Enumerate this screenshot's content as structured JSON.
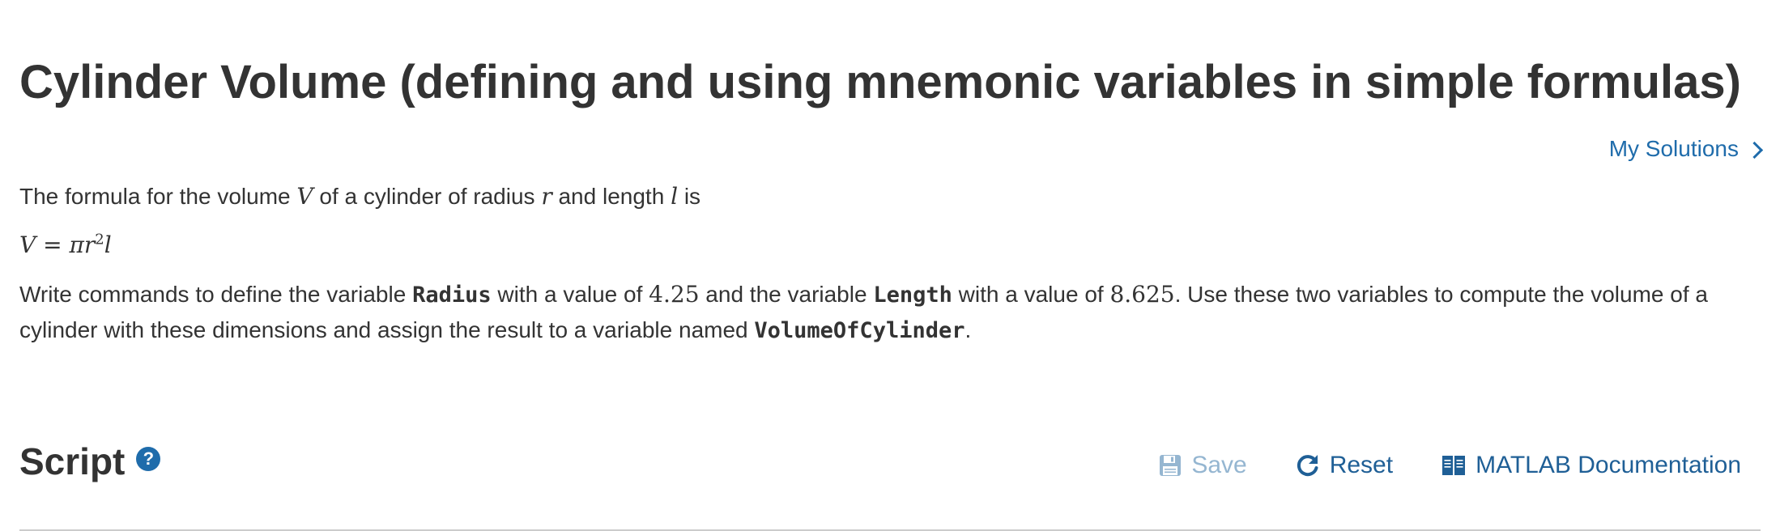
{
  "header": {
    "title": "Cylinder Volume (defining and using mnemonic variables in simple formulas)",
    "my_solutions_label": "My Solutions"
  },
  "problem": {
    "p1": {
      "t1": "The formula for the volume",
      "var_V": "V",
      "t2": "of a cylinder of radius",
      "var_r": "r",
      "t3": "and length",
      "var_l": "l",
      "t4": "is"
    },
    "formula": {
      "lhs": "V = πr",
      "exp": "2",
      "rhs": "l"
    },
    "p2": {
      "t1": "Write commands to define the variable",
      "code_radius": "Radius",
      "t2": "with a value of",
      "num_radius": "4.25",
      "t3": "and the variable",
      "code_length": "Length",
      "t4": "with a value of",
      "num_length": "8.625",
      "t5": ". Use these two variables to compute the volume of a cylinder with these dimensions and assign the result to a variable named",
      "code_volume": "VolumeOfCylinder",
      "t6": "."
    }
  },
  "script": {
    "title": "Script",
    "help_glyph": "?",
    "toolbar": {
      "save_label": "Save",
      "reset_label": "Reset",
      "doc_label": "MATLAB Documentation"
    }
  },
  "colors": {
    "link": "#1f6cab",
    "text": "#333333",
    "disabled": "#95b6d1"
  },
  "icons": [
    "chevron-right-icon",
    "help-icon",
    "save-icon",
    "reset-icon",
    "book-icon"
  ]
}
